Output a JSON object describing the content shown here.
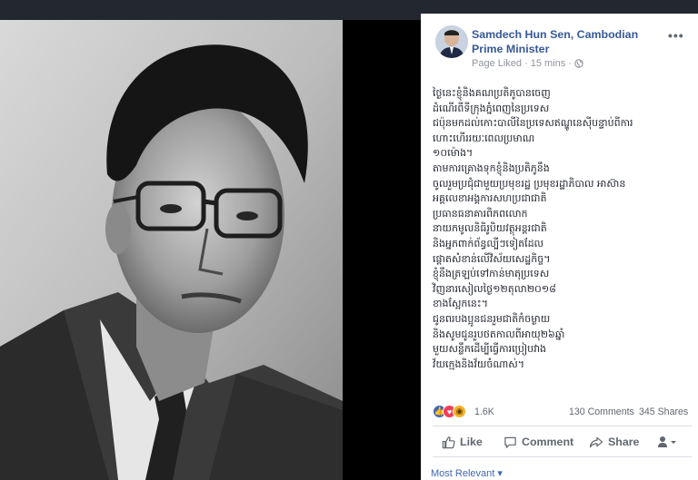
{
  "page": {
    "name": "Samdech Hun Sen, Cambodian Prime Minister",
    "meta_liked": "Page Liked",
    "meta_dot": "·",
    "meta_time": "15 mins",
    "meta_dot2": "·",
    "more_label": "•••"
  },
  "post": {
    "lines": [
      "ថ្ងៃនេះខ្ញុំនិងគណប្រតិភូបានចេញ",
      "ដំណើរពីទីក្រុងភ្នំពេញនៃប្រទេស",
      "ជប៉ុនមកដល់កោះបាលីនៃប្រទេសឥណ្ឌូនេស៊ីបន្ទាប់ពីការ",
      "ហោះហើររយៈពេលប្រមាណ",
      "១០ម៉ោង។",
      "តាមការគ្រោងទុកខ្ញុំនិងប្រតិភូនឹង",
      "ចូលរួមប្រជុំជាមួយប្រមុខរដ្ឋ ប្រមុខរដ្ឋាភិបាល អាស៊ាន",
      "អគ្គលេខាអង្គការសហប្រជាជាតិ",
      "ប្រធានធនាគារពិភពលោក",
      "នាយកមូលនិធិរូបិយវត្ថុអន្តរជាតិ",
      "និងអ្នកពាក់ព័ន្ធល្បីៗទៀតដែល",
      "ផ្តោតសំខាន់លើវិស័យសេដ្ឋកិច្ច។",
      "ខ្ញុំនឹងត្រឡប់ទៅកាន់មាតុប្រទេស",
      "វិញនារសៀលថ្ងៃ១២តុលា២០១៨",
      "ខាងស្អែកនេះ។",
      "ជូនពរបងប្អូនជនរួមជាតិកំចម្ងាយ",
      "និងសូមជូនរួបថតកាលពីអាយុ២៦ឆ្នាំ",
      "មួយសន្លឹកដើម្បីធ្វើការប្រៀបវាង",
      "វ័យក្មេងនិងវ័យចំណាស់។"
    ]
  },
  "stats": {
    "reaction_count": "1.6K",
    "comments": "130 Comments",
    "shares": "345 Shares"
  },
  "actions": {
    "like": "Like",
    "comment": "Comment",
    "share": "Share"
  },
  "comments_sort": "Most Relevant ▾",
  "colors": {
    "link_blue": "#365899",
    "muted": "#90949c",
    "like_blue": "#4267b2",
    "love_red": "#f33e58",
    "wow_yellow": "#f7b125"
  },
  "icons": {
    "avatar": "avatar-photo",
    "globe": "globe-icon",
    "like": "thumbs-up-icon",
    "comment": "speech-bubble-icon",
    "share": "share-arrow-icon",
    "audience": "person-dropdown-icon",
    "reactions": [
      "like-reaction-icon",
      "love-reaction-icon",
      "wow-reaction-icon"
    ]
  }
}
